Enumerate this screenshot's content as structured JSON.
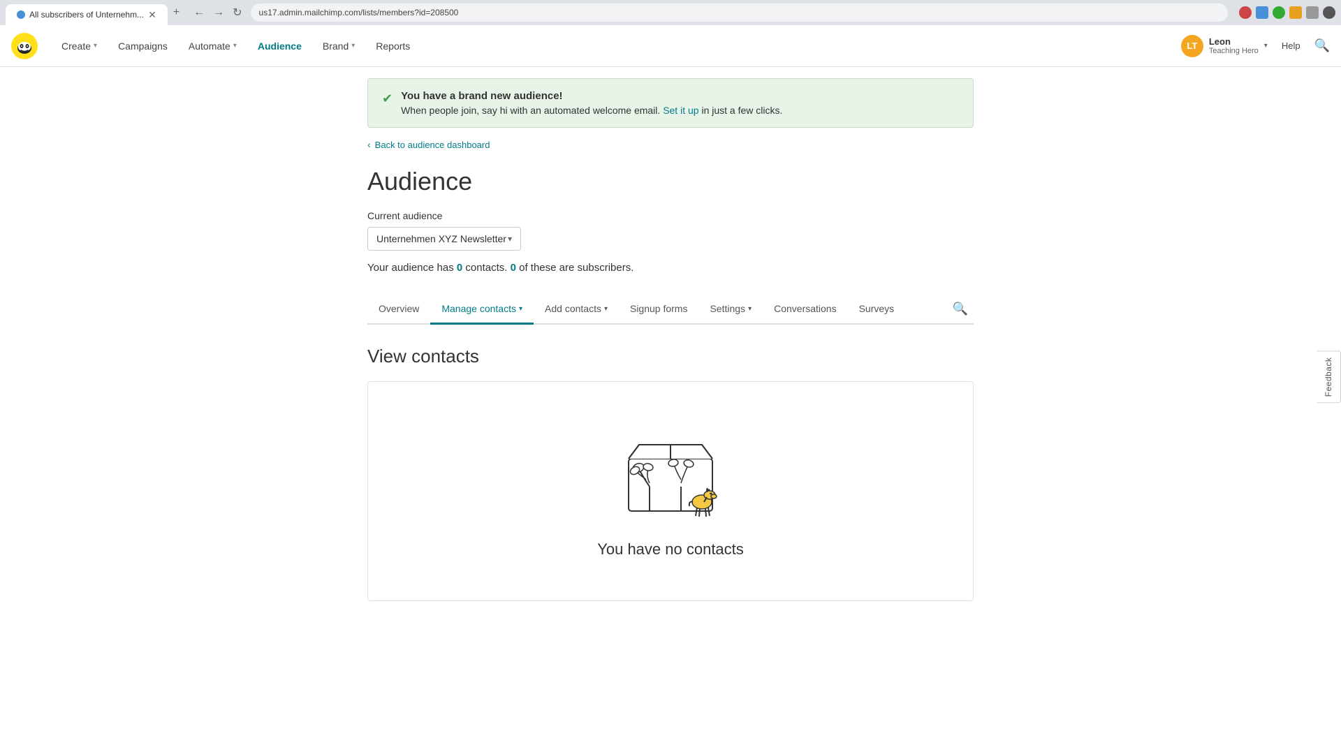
{
  "browser": {
    "tab_title": "All subscribers of Unternehm...",
    "tab_new_label": "+",
    "url": "us17.admin.mailchimp.com/lists/members?id=208500",
    "nav_back": "←",
    "nav_forward": "→",
    "nav_refresh": "↻"
  },
  "topnav": {
    "create_label": "Create",
    "campaigns_label": "Campaigns",
    "automate_label": "Automate",
    "audience_label": "Audience",
    "brand_label": "Brand",
    "reports_label": "Reports",
    "help_label": "Help",
    "user": {
      "initials": "LT",
      "name": "Leon",
      "role": "Teaching Hero"
    }
  },
  "banner": {
    "title": "You have a brand new audience!",
    "text_before_link": "When people join, say hi with an automated welcome email.",
    "link_text": "Set it up",
    "text_after_link": "in just a few clicks."
  },
  "breadcrumb": {
    "back_label": "Back to audience dashboard"
  },
  "page": {
    "title": "Audience",
    "current_audience_label": "Current audience",
    "audience_name": "Unternehmen XYZ Newsletter",
    "contacts_text_1": "Your audience has",
    "contacts_count_1": "0",
    "contacts_text_2": "contacts.",
    "contacts_count_2": "0",
    "contacts_text_3": "of these are subscribers."
  },
  "subnav": {
    "items": [
      {
        "label": "Overview",
        "active": false
      },
      {
        "label": "Manage contacts",
        "active": true,
        "has_chevron": true
      },
      {
        "label": "Add contacts",
        "active": false,
        "has_chevron": true
      },
      {
        "label": "Signup forms",
        "active": false
      },
      {
        "label": "Settings",
        "active": false,
        "has_chevron": true
      },
      {
        "label": "Conversations",
        "active": false
      },
      {
        "label": "Surveys",
        "active": false
      }
    ]
  },
  "view_contacts": {
    "title": "View contacts",
    "empty_title": "You have no contacts"
  },
  "feedback": {
    "label": "Feedback"
  }
}
